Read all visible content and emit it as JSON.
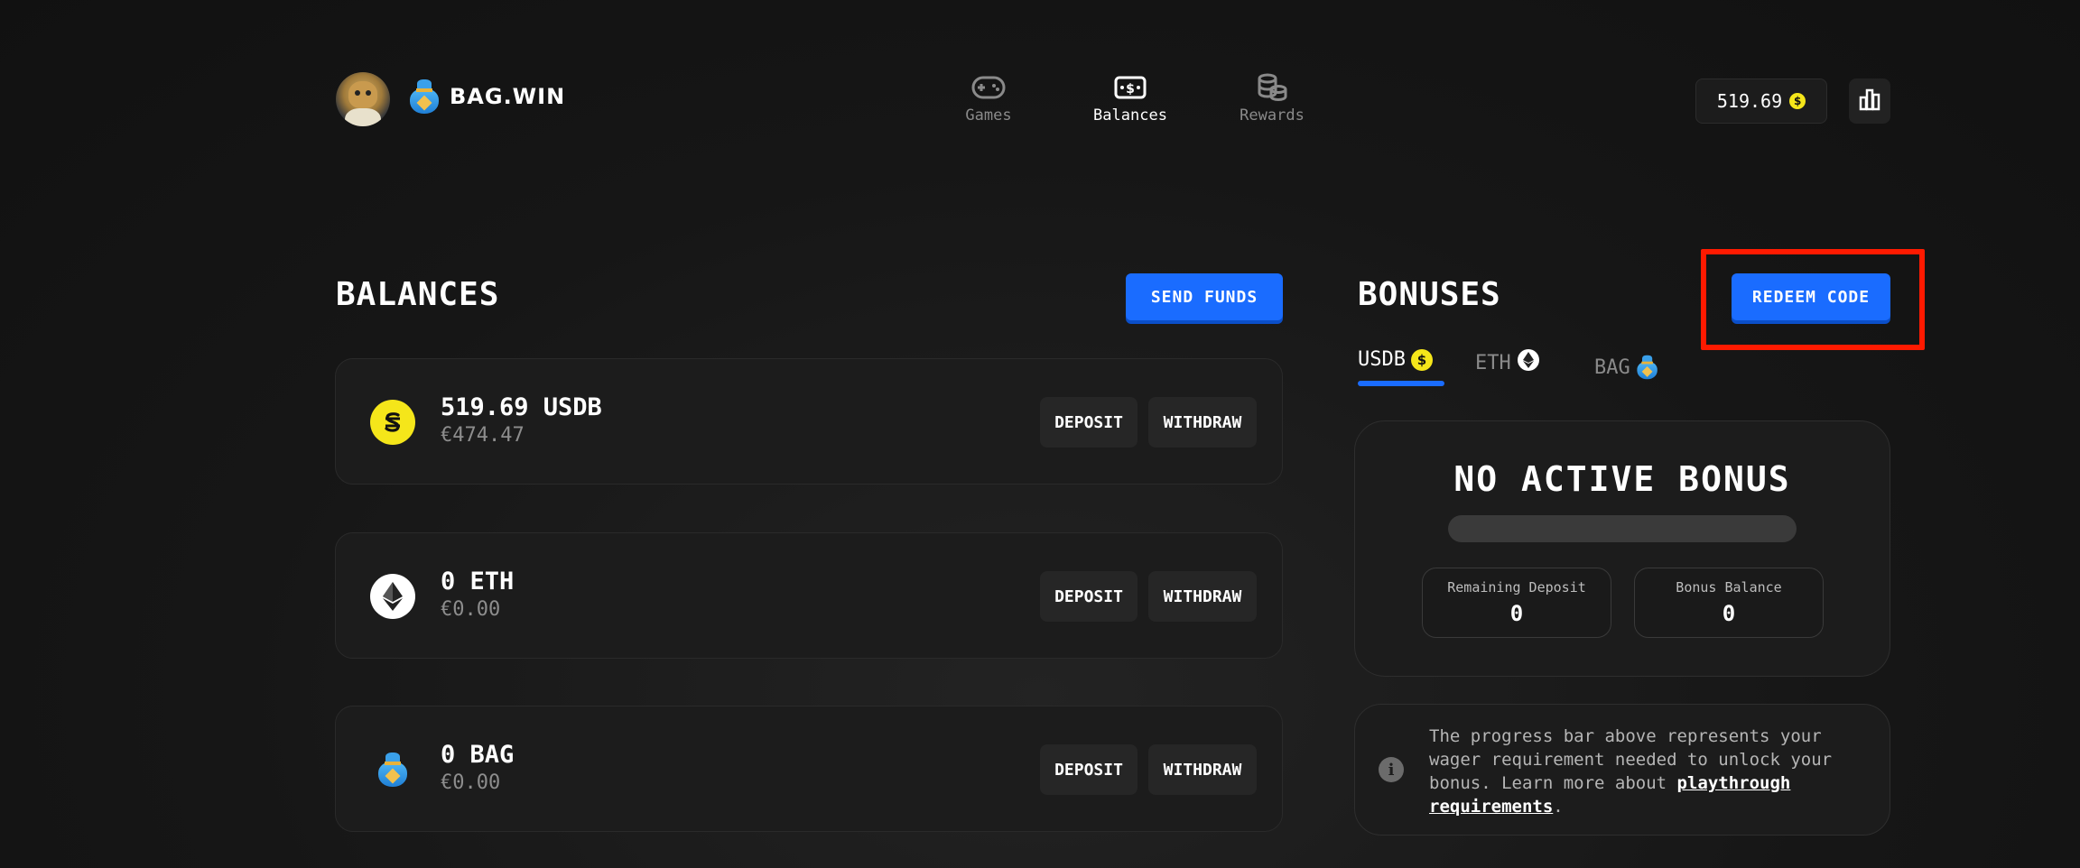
{
  "header": {
    "brand": "BAG.WIN",
    "nav": [
      {
        "label": "Games",
        "icon": "gamepad-icon",
        "active": false
      },
      {
        "label": "Balances",
        "icon": "cash-icon",
        "active": true
      },
      {
        "label": "Rewards",
        "icon": "coins-icon",
        "active": false
      }
    ],
    "balance_value": "519.69",
    "balance_coin_symbol": "$",
    "stats_icon": "bar-chart-icon"
  },
  "balances": {
    "title": "BALANCES",
    "send_funds_label": "SEND FUNDS",
    "cards": [
      {
        "amount": "519.69 USDB",
        "fiat": "€474.47",
        "icon": "usdb-coin-icon",
        "deposit_label": "DEPOSIT",
        "withdraw_label": "WITHDRAW"
      },
      {
        "amount": "0 ETH",
        "fiat": "€0.00",
        "icon": "eth-coin-icon",
        "deposit_label": "DEPOSIT",
        "withdraw_label": "WITHDRAW"
      },
      {
        "amount": "0 BAG",
        "fiat": "€0.00",
        "icon": "bag-coin-icon",
        "deposit_label": "DEPOSIT",
        "withdraw_label": "WITHDRAW"
      }
    ]
  },
  "bonuses": {
    "title": "BONUSES",
    "redeem_label": "REDEEM CODE",
    "tabs": [
      {
        "label": "USDB",
        "icon": "usdb-coin-icon",
        "active": true
      },
      {
        "label": "ETH",
        "icon": "eth-coin-icon",
        "active": false
      },
      {
        "label": "BAG",
        "icon": "bag-coin-icon",
        "active": false
      }
    ],
    "status": "NO ACTIVE BONUS",
    "progress": 0,
    "remaining_deposit_label": "Remaining Deposit",
    "remaining_deposit_value": "0",
    "bonus_balance_label": "Bonus Balance",
    "bonus_balance_value": "0",
    "info_text": "The progress bar above represents your wager requirement needed to unlock your bonus. Learn more about ",
    "info_link": "playthrough requirements",
    "info_tail": "."
  },
  "colors": {
    "accent": "#1a6cff",
    "usdb": "#f5e61a",
    "highlight": "#ff1a00"
  }
}
